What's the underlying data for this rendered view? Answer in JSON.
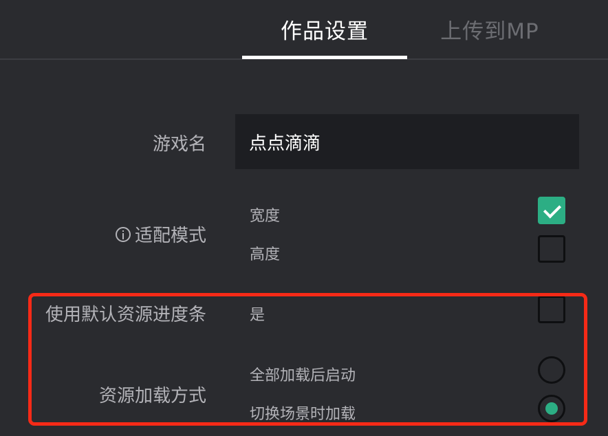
{
  "tabs": {
    "settings_label": "作品设置",
    "upload_label": "上传到MP"
  },
  "game_name": {
    "label": "游戏名",
    "value": "点点滴滴"
  },
  "adapt_mode": {
    "label": "适配模式",
    "options": [
      {
        "label": "宽度",
        "checked": true
      },
      {
        "label": "高度",
        "checked": false
      }
    ]
  },
  "default_progress_bar": {
    "label": "使用默认资源进度条",
    "option_label": "是",
    "checked": false
  },
  "resource_loading": {
    "label": "资源加载方式",
    "options": [
      {
        "label": "全部加载后启动",
        "selected": false
      },
      {
        "label": "切换场景时加载",
        "selected": true
      }
    ]
  },
  "colors": {
    "background": "#2a2b2f",
    "input_background": "#1d1e22",
    "accent": "#2cae84",
    "highlight_border": "#f52a17"
  },
  "icons": [
    "info-icon",
    "check-icon",
    "radio-dot-icon"
  ]
}
